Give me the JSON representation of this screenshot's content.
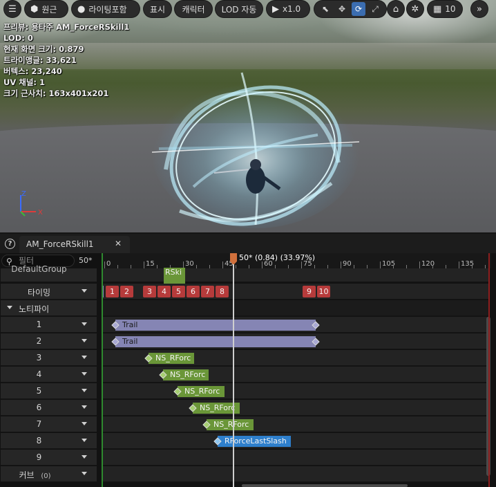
{
  "toolbar": {
    "perspective": "원근",
    "lighting": "라이팅포함",
    "show": "표시",
    "character": "캐릭터",
    "lod": "LOD 자동",
    "speed": "x1.0",
    "grid_value": "10"
  },
  "stats": {
    "preview": "프리뷰: 용타주 AM_ForceRSkill1",
    "lod": "LOD: 0",
    "screen_size": "현재 화면 크기: 0.879",
    "triangles": "트라이앵글: 33,621",
    "vertices": "버텍스: 23,240",
    "uv_channels": "UV 채널: 1",
    "approx_size": "크기 근사치: 163x401x201"
  },
  "axis": {
    "z": "Z",
    "x": "X"
  },
  "panel": {
    "tab_title": "AM_ForceRSkill1",
    "filter_placeholder": "필터",
    "frame_count": "50*",
    "playhead_text": "50* (0.84) (33.97%)"
  },
  "ruler": {
    "ticks": [
      "0",
      "15",
      "30",
      "45",
      "60",
      "75",
      "90",
      "105",
      "120",
      "135"
    ]
  },
  "tracks": {
    "default_group": "DefaultGroup",
    "rski_label": "RSki",
    "timing": "타이밍",
    "notifies": "노티파이",
    "rows": [
      "1",
      "2",
      "3",
      "4",
      "5",
      "6",
      "7",
      "8",
      "9"
    ],
    "curves": "커브",
    "curves_count": "(0)"
  },
  "timing_markers": [
    "1",
    "2",
    "3",
    "4",
    "5",
    "6",
    "7",
    "8",
    "9",
    "10"
  ],
  "notify_bars": [
    {
      "row": 1,
      "label": "Trail"
    },
    {
      "row": 2,
      "label": "Trail"
    },
    {
      "row": 3,
      "label": "NS_RForc"
    },
    {
      "row": 4,
      "label": "NS_RForc"
    },
    {
      "row": 5,
      "label": "NS_RForc"
    },
    {
      "row": 6,
      "label": "NS_RForc"
    },
    {
      "row": 7,
      "label": "NS_RForc"
    },
    {
      "row": 8,
      "label": "RForceLastSlash"
    }
  ],
  "colors": {
    "timing_red": "#b63b3b",
    "trail_purple": "#8585b4",
    "notify_green": "#6a9638",
    "notify_blue": "#2e7fcc",
    "playhead_orange": "#d0703c"
  }
}
